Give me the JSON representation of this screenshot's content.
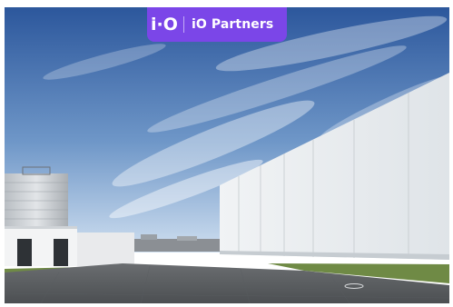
{
  "brand": {
    "mark": "i·O",
    "name": "iO Partners",
    "color": "#7b46e8"
  },
  "photo": {
    "colors": {
      "sky_top": "#2f5aa0",
      "sky_bottom": "#c9dcef",
      "warehouse_wall": "#e7ebee",
      "pavement": "#5b5f63",
      "grass": "#6f8a45"
    }
  }
}
